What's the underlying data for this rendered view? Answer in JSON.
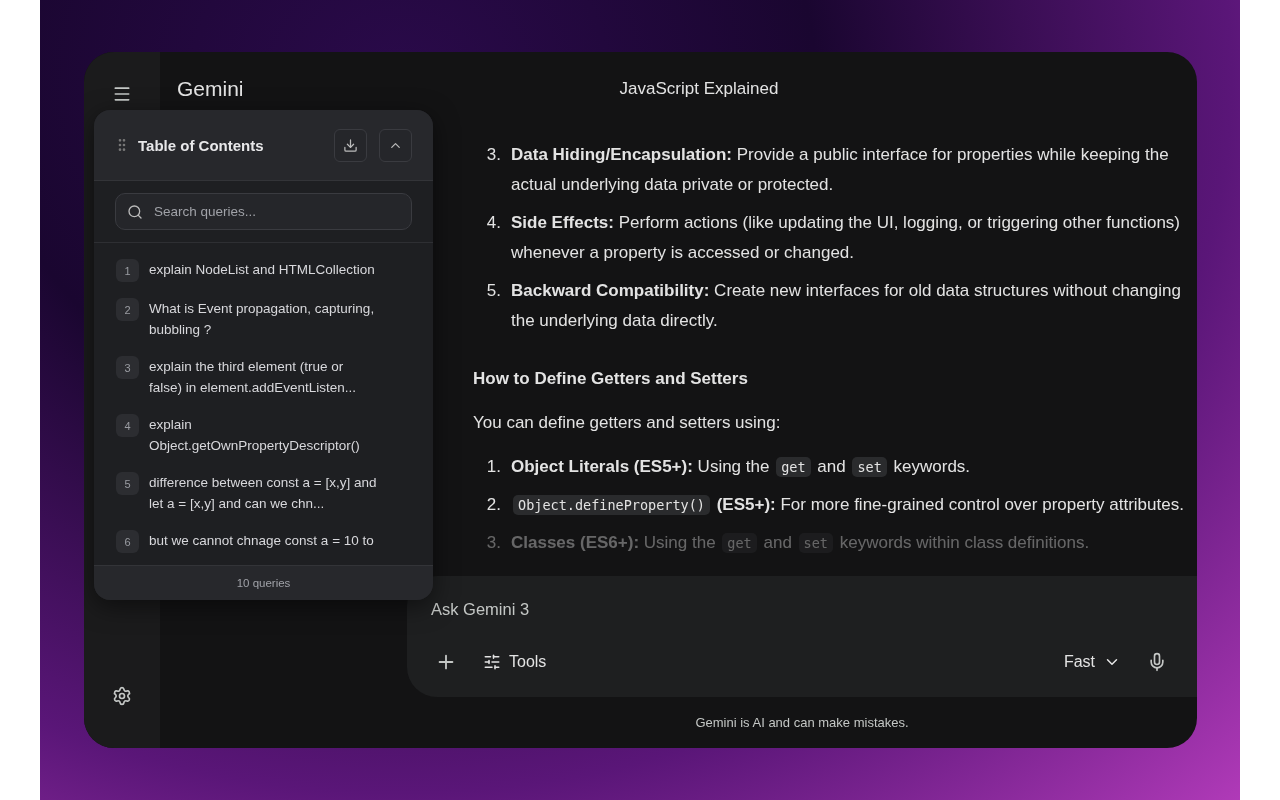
{
  "app": {
    "name": "Gemini",
    "conversation_title": "JavaScript Explained"
  },
  "toc": {
    "title": "Table of Contents",
    "search": {
      "placeholder": "Search queries..."
    },
    "items": [
      {
        "number": "1",
        "text": "explain NodeList and HTMLCollection"
      },
      {
        "number": "2",
        "text": "What is Event propagation, capturing, bubbling ?"
      },
      {
        "number": "3",
        "text": "explain the third element (true or false) in element.addEventListen..."
      },
      {
        "number": "4",
        "text": "explain Object.getOwnPropertyDescriptor()"
      },
      {
        "number": "5",
        "text": "difference between const a = [x,y] and let a = [x,y] and can we chn..."
      },
      {
        "number": "6",
        "text": "but we cannot chnage const a = 10 to"
      }
    ],
    "footer": "10 queries"
  },
  "content": [
    {
      "kind": "list",
      "items": [
        {
          "number": "3.",
          "text": "**Data Hiding/Encapsulation:** Provide a public interface for properties while keeping the actual underlying data private or protected.",
          "faded": false
        },
        {
          "number": "4.",
          "text": "**Side Effects:** Perform actions (like updating the UI, logging, or triggering other functions) whenever a property is accessed or changed.",
          "faded": false
        },
        {
          "number": "5.",
          "text": "**Backward Compatibility:** Create new interfaces for old data structures without changing the underlying data directly.",
          "faded": false
        }
      ]
    },
    {
      "kind": "heading",
      "text": "How to Define Getters and Setters"
    },
    {
      "kind": "paragraph",
      "text": "You can define getters and setters using:"
    },
    {
      "kind": "list",
      "items": [
        {
          "number": "1.",
          "parts": [
            {
              "kind": "bold",
              "text": "Object Literals (ES5+):"
            },
            {
              "kind": "text",
              "text": "Using the"
            },
            {
              "kind": "code",
              "text": "get"
            },
            {
              "kind": "text",
              "text": "and"
            },
            {
              "kind": "code",
              "text": "set"
            },
            {
              "kind": "text",
              "text": "keywords."
            }
          ],
          "faded": false
        },
        {
          "number": "2.",
          "parts": [
            {
              "kind": "code",
              "text": "Object.defineProperty()"
            },
            {
              "kind": "bold",
              "text": "(ES5+):"
            },
            {
              "kind": "text",
              "text": "For more fine-grained control over property attributes."
            }
          ],
          "faded": false
        },
        {
          "number": "3.",
          "parts": [
            {
              "kind": "bold",
              "text": "Classes (ES6+):"
            },
            {
              "kind": "text",
              "text": "Using the"
            },
            {
              "kind": "code",
              "text": "get"
            },
            {
              "kind": "text",
              "text": "and"
            },
            {
              "kind": "code",
              "text": "set"
            },
            {
              "kind": "text",
              "text": "keywords within class definitions."
            }
          ],
          "faded": true
        }
      ]
    }
  ],
  "composer": {
    "placeholder": "Ask Gemini 3",
    "tools_label": "Tools",
    "model": "Fast"
  },
  "disclaimer": "Gemini is AI and can make mistakes."
}
